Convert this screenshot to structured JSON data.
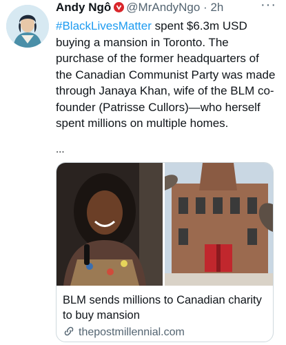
{
  "tweet": {
    "author_name": "Andy Ngô",
    "handle": "@MrAndyNgo",
    "separator": "·",
    "time": "2h",
    "more": "···",
    "hashtag": "#BlackLivesMatter",
    "body": " spent $6.3m USD buying a mansion in Toronto. The purchase of the former headquarters of the Canadian Communist Party was made through Janaya Khan, wife of the BLM co-founder (Patrisse Cullors)—who herself spent millions on multiple homes.",
    "ellipsis": "..."
  },
  "card": {
    "title": "BLM sends millions to Canadian charity to buy mansion",
    "domain": "thepostmillennial.com"
  },
  "icons": {
    "verified": "red-badge-icon",
    "link": "link-icon",
    "more": "more-icon"
  },
  "colors": {
    "hashtag": "#1d9bf0",
    "muted": "#536471",
    "badge": "#d9262b",
    "border": "#cfd9de"
  }
}
